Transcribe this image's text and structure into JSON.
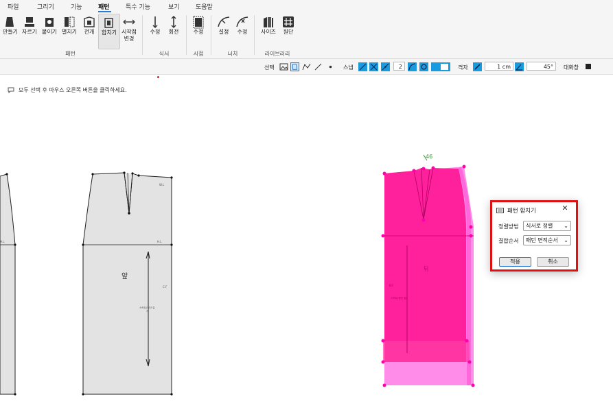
{
  "menu": {
    "items": [
      {
        "id": "file",
        "label": "파일"
      },
      {
        "id": "draw",
        "label": "그리기"
      },
      {
        "id": "function",
        "label": "기능"
      },
      {
        "id": "pattern",
        "label": "패턴"
      },
      {
        "id": "special",
        "label": "특수 기능"
      },
      {
        "id": "view",
        "label": "보기"
      },
      {
        "id": "help",
        "label": "도움말"
      }
    ],
    "active": "패턴"
  },
  "ribbon": {
    "groups": [
      {
        "id": "pattern",
        "label": "패턴",
        "buttons": [
          "만들기",
          "자르기",
          "붙이기",
          "펼치기",
          "전개",
          "합치기",
          "시작점",
          "변경"
        ]
      },
      {
        "id": "seam",
        "label": "식서",
        "buttons": [
          "수정",
          "회전"
        ]
      },
      {
        "id": "start",
        "label": "시접",
        "buttons": [
          "수정"
        ]
      },
      {
        "id": "notch",
        "label": "너치",
        "buttons": [
          "설정",
          "수정"
        ]
      },
      {
        "id": "library",
        "label": "라이브러리",
        "buttons": [
          "사이즈",
          "원단"
        ]
      }
    ],
    "selected_button": "합치기"
  },
  "toolbar": {
    "select_label": "선택",
    "snap_label": "스냅",
    "snap_count": "2",
    "grid_label": "격자",
    "grid_size": "1 cm",
    "angle": "45°",
    "dialog_label": "대화창"
  },
  "hint": {
    "text": "모두 선택 후 마우스 오른쪽 버튼을 클릭하세요."
  },
  "canvas": {
    "front_piece_label": "앞",
    "overlay_label_top": "46",
    "overlay_label_mid": "뒤",
    "colors": {
      "piece_fill": "#e3e3e3",
      "overlay_pink": "#ff1493",
      "overlay_light": "#ff7fe6",
      "notch_green": "#2aa02a"
    }
  },
  "dialog": {
    "title": "패턴 합치기",
    "sort_label": "정렬방법",
    "sort_value": "식서로 정렬",
    "merge_label": "결합순서",
    "merge_value": "패턴 면적순서",
    "apply_button": "적용",
    "cancel_button": "취소",
    "highlight_color": "#e01010"
  }
}
